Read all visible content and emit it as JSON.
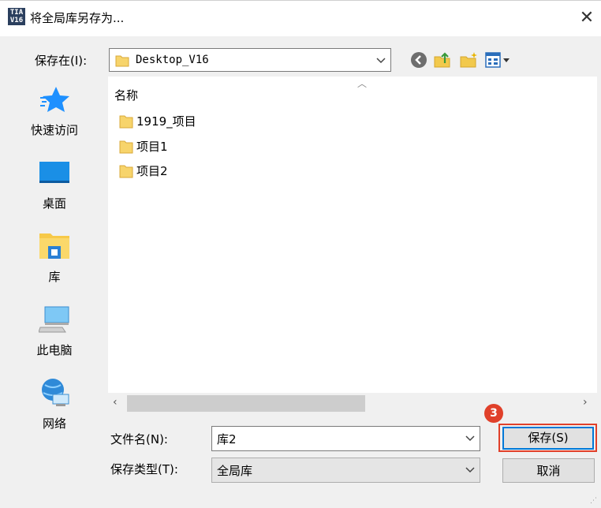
{
  "window": {
    "app_icon_text": "TIA V16",
    "title": "将全局库另存为...",
    "close_glyph": "✕"
  },
  "lookin": {
    "label": "保存在(I):",
    "value": "Desktop_V16"
  },
  "toolbar": {
    "icons": [
      "back-icon",
      "up-folder-icon",
      "new-folder-icon",
      "view-menu-icon"
    ]
  },
  "places": [
    {
      "label": "快速访问",
      "icon": "quick-access-star-icon"
    },
    {
      "label": "桌面",
      "icon": "desktop-icon"
    },
    {
      "label": "库",
      "icon": "libraries-icon"
    },
    {
      "label": "此电脑",
      "icon": "this-pc-icon"
    },
    {
      "label": "网络",
      "icon": "network-icon"
    }
  ],
  "filelist": {
    "column_header": "名称",
    "items": [
      {
        "name": "1919_项目"
      },
      {
        "name": "项目1"
      },
      {
        "name": "项目2"
      }
    ]
  },
  "filename": {
    "label": "文件名(N):",
    "value": "库2"
  },
  "filetype": {
    "label": "保存类型(T):",
    "value": "全局库"
  },
  "buttons": {
    "save": "保存(S)",
    "cancel": "取消"
  },
  "annotation": {
    "step_number": "3"
  },
  "colors": {
    "accent": "#0078d7",
    "annotation_red": "#e0402a",
    "folder_yellow": "#f7d46b"
  }
}
